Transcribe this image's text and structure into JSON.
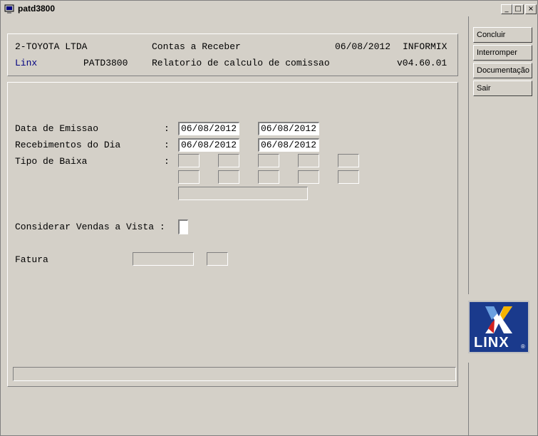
{
  "window": {
    "title": "patd3800",
    "min_glyph": "_",
    "max_glyph": "□",
    "close_glyph": "×"
  },
  "header": {
    "company": "2-TOYOTA LTDA",
    "module": "Contas a Receber",
    "date": "06/08/2012",
    "db": "INFORMIX",
    "brand": "Linx",
    "program": "PATD3800",
    "report_title": "Relatorio de calculo de comissao",
    "version": "v04.60.01",
    "brand_color": "#000080"
  },
  "form": {
    "data_emissao_label": "Data de Emissao",
    "recebimentos_label": "Recebimentos do Dia",
    "tipo_baixa_label": "Tipo de Baixa",
    "considerar_label": "Considerar Vendas a Vista :",
    "fatura_label": "Fatura",
    "colon": ":",
    "data_emissao_from": "06/08/2012",
    "data_emissao_to": "06/08/2012",
    "recebimentos_from": "06/08/2012",
    "recebimentos_to": "06/08/2012"
  },
  "buttons": {
    "concluir": "Concluir",
    "interromper": "Interromper",
    "documentacao": "Documentação",
    "sair": "Sair"
  },
  "logo": {
    "text": "LINX",
    "reg": "®",
    "bg": "#1a3a8c"
  }
}
